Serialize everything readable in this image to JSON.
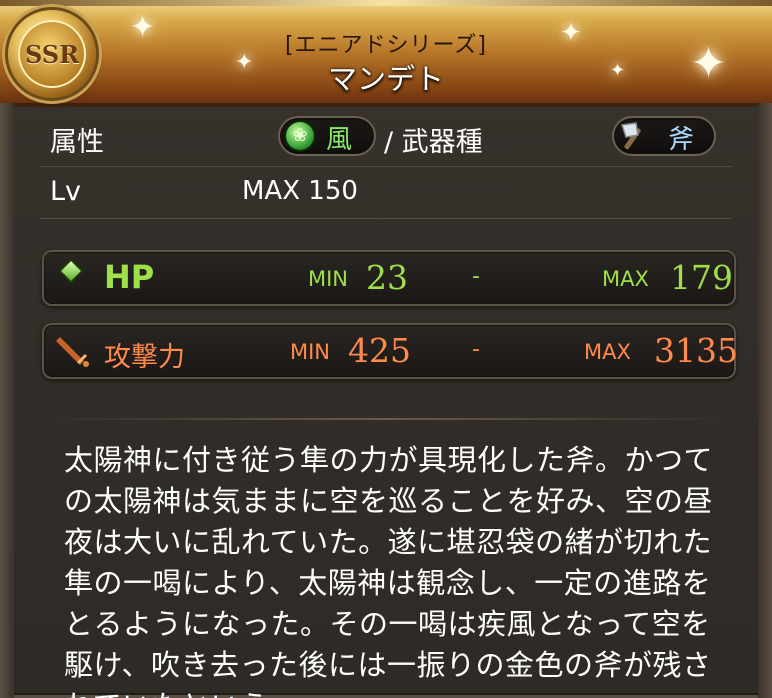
{
  "header": {
    "rarity": "SSR",
    "series": "[エニアドシリーズ]",
    "name": "マンデト"
  },
  "info": {
    "element_label": "属性",
    "element_value": "風",
    "weapon_type_label": "/ 武器種",
    "weapon_type_value": "斧",
    "level_label": "Lv",
    "level_value": "MAX 150"
  },
  "stats": {
    "hp": {
      "label": "HP",
      "min_label": "MIN",
      "min": "23",
      "sep": "-",
      "max_label": "MAX",
      "max": "179",
      "color": "#9fe04a"
    },
    "attack": {
      "label": "攻撃力",
      "min_label": "MIN",
      "min": "425",
      "sep": "-",
      "max_label": "MAX",
      "max": "3135",
      "color": "#ff8a4a"
    }
  },
  "description": "太陽神に付き従う隼の力が具現化した斧。かつての太陽神は気ままに空を巡ることを好み、空の昼夜は大いに乱れていた。遂に堪忍袋の緒が切れた隼の一喝により、太陽神は観念し、一定の進路をとるようになった。その一喝は疾風となって空を駆け、吹き去った後には一振りの金色の斧が残されていたという。"
}
